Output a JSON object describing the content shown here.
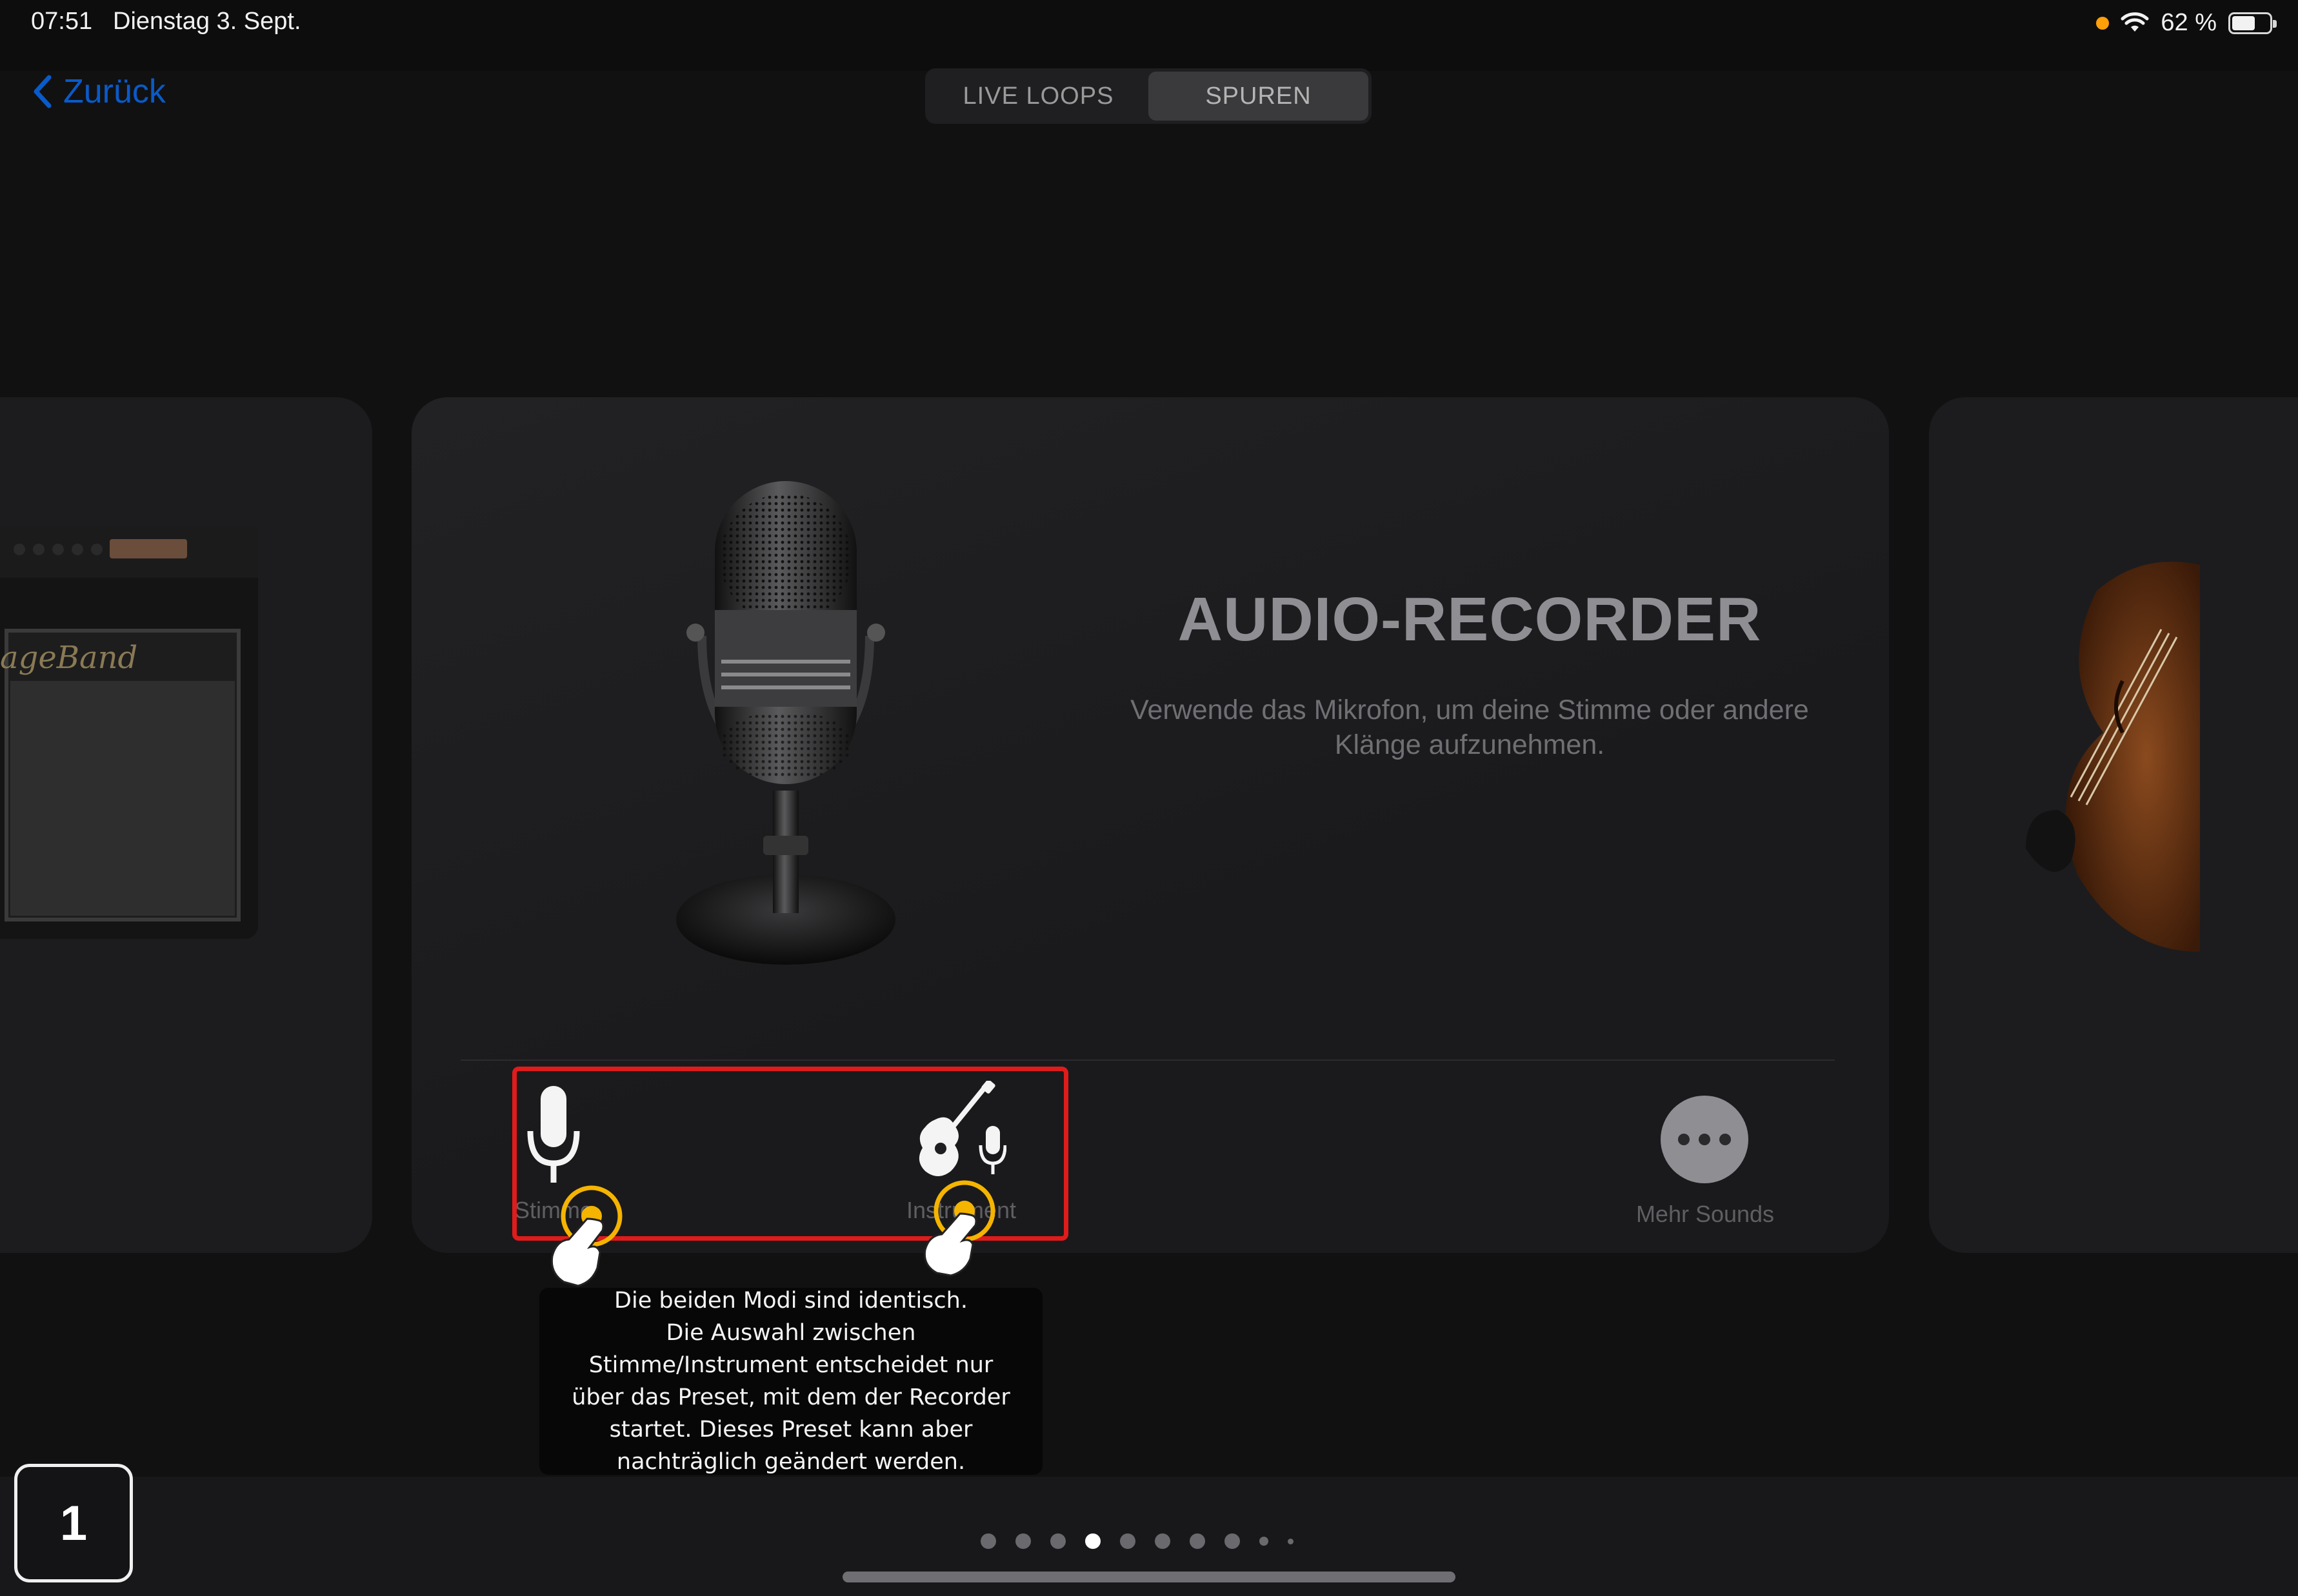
{
  "status_bar": {
    "time": "07:51",
    "date": "Dienstag 3. Sept.",
    "battery_text": "62 %",
    "battery_level": 0.62
  },
  "nav": {
    "back_label": "Zurück",
    "segments": [
      "LIVE LOOPS",
      "SPUREN"
    ],
    "active_segment": "SPUREN"
  },
  "card": {
    "title": "AUDIO-RECORDER",
    "description": "Verwende das Mikrofon, um deine Stimme oder andere Klänge aufzunehmen.",
    "left_amp_brand": "GarageBand",
    "modes": [
      {
        "label": "Stimme",
        "icon": "microphone-icon"
      },
      {
        "label": "Instrument",
        "icon": "guitar-microphone-icon"
      }
    ],
    "more_label": "Mehr Sounds"
  },
  "tooltip": {
    "text": "Die beiden Modi sind identisch.\nDie Auswahl zwischen\nStimme/Instrument entscheidet nur\nüber das Preset, mit dem der Recorder\nstartet. Dieses Preset kann aber\nnachträglich geändert werden."
  },
  "step_badge": "1",
  "pagination": {
    "count": 10,
    "active_index": 3
  },
  "colors": {
    "accent": "#0a5ac8",
    "highlight": "#e01b1b",
    "tap_ring": "#f5b400"
  }
}
